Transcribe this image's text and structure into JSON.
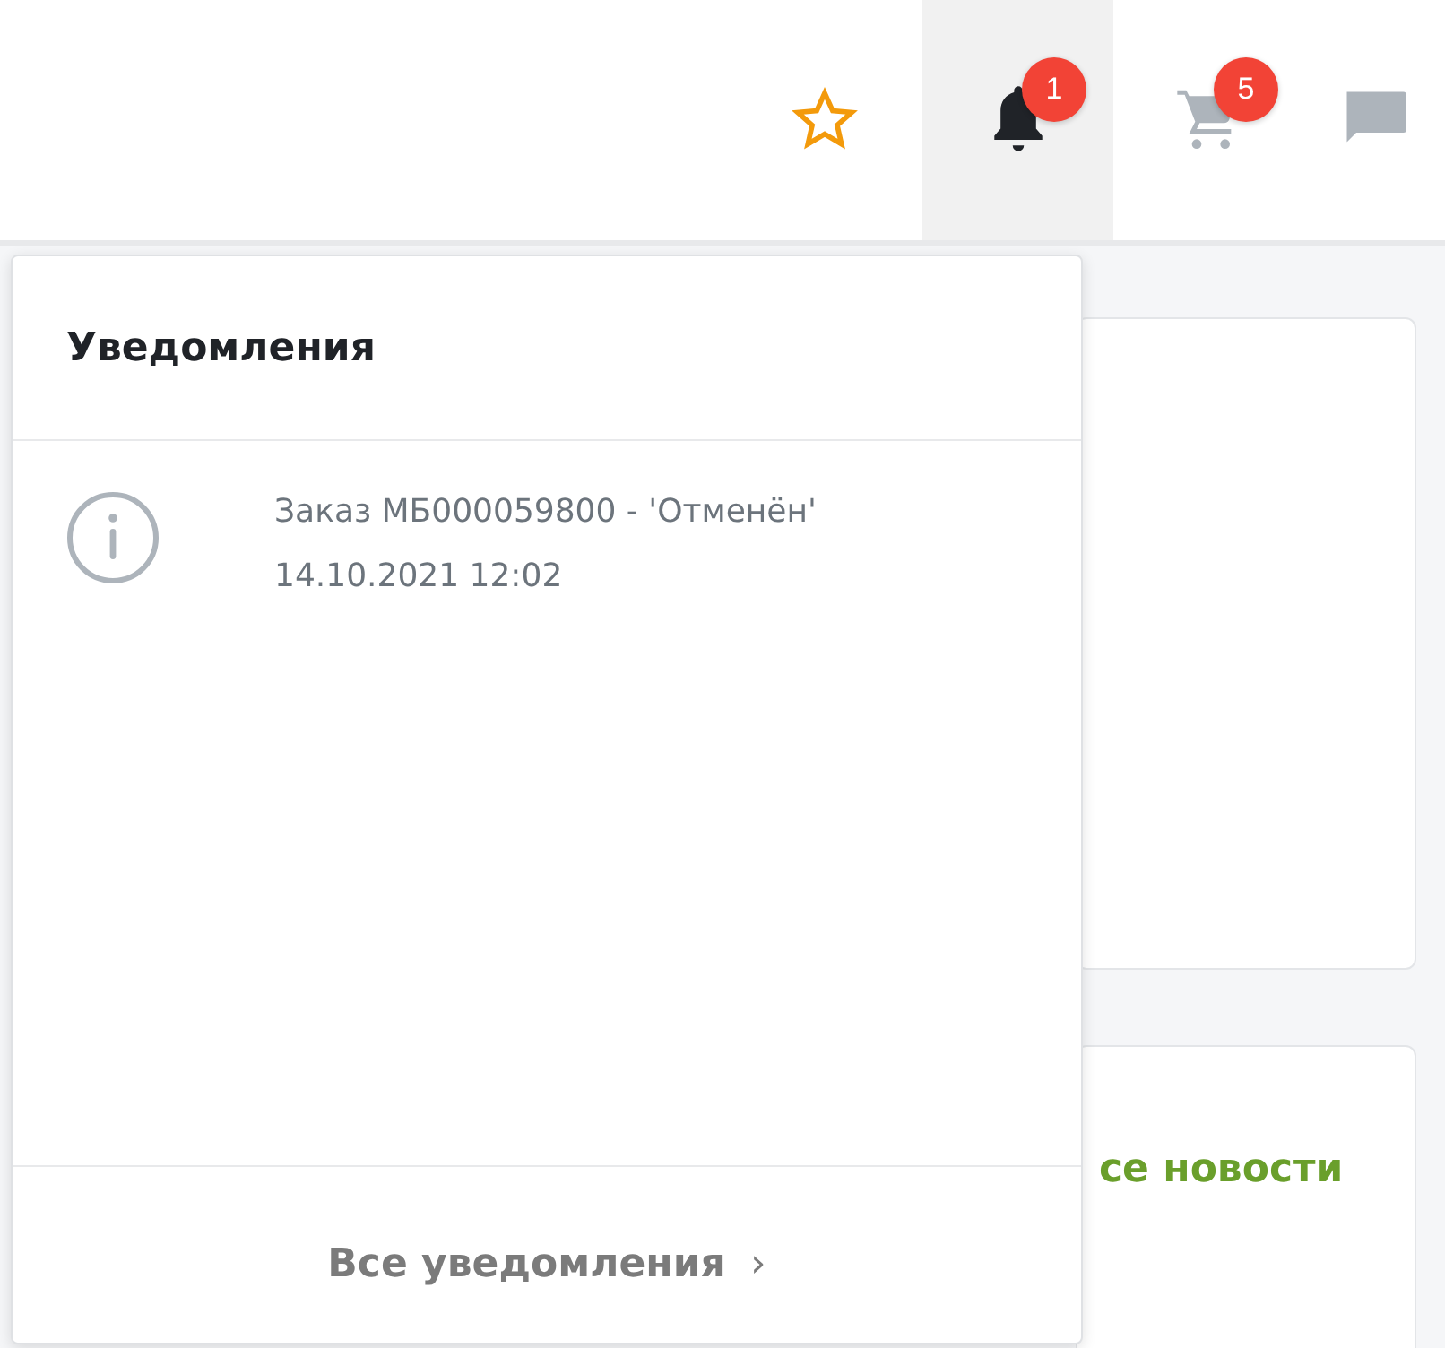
{
  "header": {
    "notifications_badge": "1",
    "cart_badge": "5",
    "notifications_open": true
  },
  "notifications_panel": {
    "title": "Уведомления",
    "items": [
      {
        "text": "Заказ МБ000059800 - 'Отменён'",
        "time": "14.10.2021 12:02"
      }
    ],
    "footer_link": "Все уведомления",
    "footer_arrow": "›"
  },
  "background": {
    "news_link": "се новости"
  }
}
